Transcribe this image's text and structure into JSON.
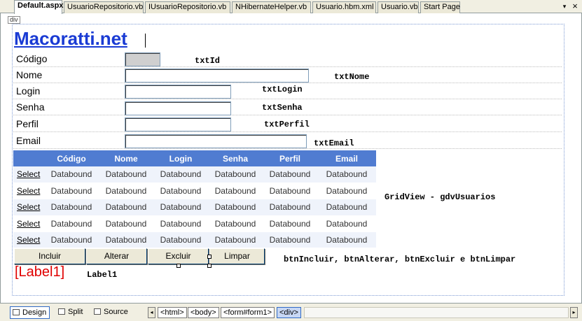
{
  "tabs": [
    {
      "label": "Default.aspx",
      "active": true
    },
    {
      "label": "UsuarioRepositorio.vb",
      "active": false
    },
    {
      "label": "IUsuarioRepositorio.vb",
      "active": false
    },
    {
      "label": "NHibernateHelper.vb",
      "active": false
    },
    {
      "label": "Usuario.hbm.xml",
      "active": false
    },
    {
      "label": "Usuario.vb",
      "active": false
    },
    {
      "label": "Start Page",
      "active": false
    }
  ],
  "tab_controls": {
    "dropdown_icon": "chevron-down-icon",
    "close_icon": "close-icon",
    "dropdown_glyph": "▾",
    "close_glyph": "×"
  },
  "design": {
    "div_tag": "div",
    "brand": "Macoratti.net",
    "fields": [
      {
        "label": "Código",
        "control_id": "txtId"
      },
      {
        "label": "Nome",
        "control_id": "txtNome"
      },
      {
        "label": "Login",
        "control_id": "txtLogin"
      },
      {
        "label": "Senha",
        "control_id": "txtSenha"
      },
      {
        "label": "Perfil",
        "control_id": "txtPerfil"
      },
      {
        "label": "Email",
        "control_id": "txtEmail"
      }
    ],
    "grid": {
      "headers": [
        "",
        "Código",
        "Nome",
        "Login",
        "Senha",
        "Perfil",
        "Email"
      ],
      "rows": [
        [
          "Select",
          "Databound",
          "Databound",
          "Databound",
          "Databound",
          "Databound",
          "Databound"
        ],
        [
          "Select",
          "Databound",
          "Databound",
          "Databound",
          "Databound",
          "Databound",
          "Databound"
        ],
        [
          "Select",
          "Databound",
          "Databound",
          "Databound",
          "Databound",
          "Databound",
          "Databound"
        ],
        [
          "Select",
          "Databound",
          "Databound",
          "Databound",
          "Databound",
          "Databound",
          "Databound"
        ],
        [
          "Select",
          "Databound",
          "Databound",
          "Databound",
          "Databound",
          "Databound",
          "Databound"
        ]
      ],
      "caption": "GridView - gdvUsuarios",
      "header_color": "#507cd1",
      "alt_row_color": "#eff3fb"
    },
    "buttons": [
      "Incluir",
      "Alterar",
      "Excluir",
      "Limpar"
    ],
    "buttons_caption": "btnIncluir, btnAlterar, btnExcluir e btnLimpar",
    "label_control": "[Label1]",
    "label_caption": "Label1",
    "brand_color": "#1a3bd4",
    "label_color": "#e00000"
  },
  "bottom": {
    "views": [
      {
        "label": "Design",
        "icon": "design-view-icon",
        "active": true
      },
      {
        "label": "Split",
        "icon": "split-view-icon",
        "active": false
      },
      {
        "label": "Source",
        "icon": "source-view-icon",
        "active": false
      }
    ],
    "breadcrumb": [
      "<html>",
      "<body>",
      "<form#form1>",
      "<div>"
    ],
    "nav_left_glyph": "◂",
    "nav_right_glyph": "▸"
  }
}
